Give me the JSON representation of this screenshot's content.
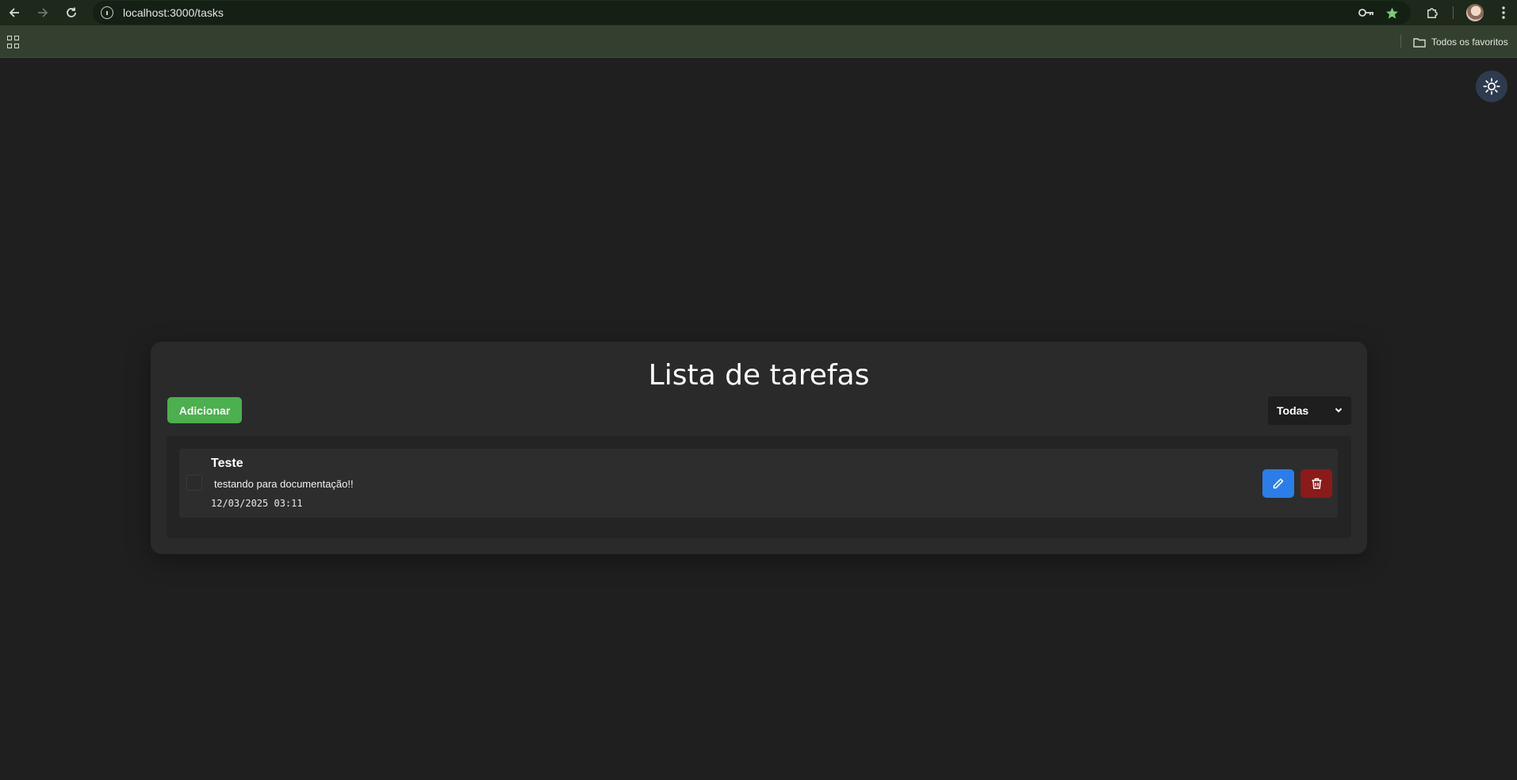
{
  "browser": {
    "url": "localhost:3000/tasks",
    "bookmarks_label": "Todos os favoritos"
  },
  "page": {
    "title": "Lista de tarefas",
    "add_label": "Adicionar",
    "filter": {
      "selected": "Todas"
    },
    "tasks": [
      {
        "title": "Teste",
        "description": "testando para documentação!!",
        "date": "12/03/2025 03:11",
        "done": false
      }
    ]
  },
  "colors": {
    "background": "#1f1f1f",
    "card": "#2a2a2a",
    "add_button": "#4caf50",
    "edit_button": "#2b7de9",
    "delete_button": "#8b1a1a",
    "theme_toggle": "#2e3b4f"
  },
  "icons": {
    "back": "arrow-left-icon",
    "forward": "arrow-right-icon",
    "reload": "reload-icon",
    "site_info": "site-info-icon",
    "password": "key-icon",
    "bookmark": "star-icon",
    "extensions": "puzzle-icon",
    "menu": "kebab-menu-icon",
    "apps": "apps-grid-icon",
    "folder": "folder-icon",
    "theme": "sun-icon",
    "edit": "pencil-icon",
    "delete": "trash-icon"
  }
}
